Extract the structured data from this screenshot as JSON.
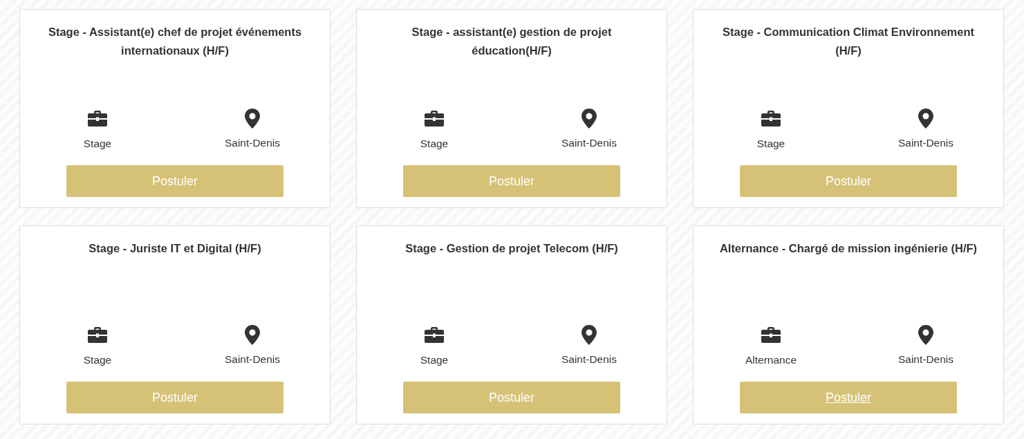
{
  "jobs": [
    {
      "title": "Stage - Assistant(e) chef de projet événements internationaux (H/F)",
      "contract_type": "Stage",
      "location": "Saint-Denis",
      "apply_button": {
        "label": "Postuler",
        "hovered": false
      }
    },
    {
      "title": "Stage - assistant(e) gestion de projet éducation(H/F)",
      "contract_type": "Stage",
      "location": "Saint-Denis",
      "apply_button": {
        "label": "Postuler",
        "hovered": false
      }
    },
    {
      "title": "Stage - Communication Climat Environnement (H/F)",
      "contract_type": "Stage",
      "location": "Saint-Denis",
      "apply_button": {
        "label": "Postuler",
        "hovered": false
      }
    },
    {
      "title": "Stage - Juriste IT et Digital (H/F)",
      "contract_type": "Stage",
      "location": "Saint-Denis",
      "apply_button": {
        "label": "Postuler",
        "hovered": false
      }
    },
    {
      "title": "Stage - Gestion de projet Telecom (H/F)",
      "contract_type": "Stage",
      "location": "Saint-Denis",
      "apply_button": {
        "label": "Postuler",
        "hovered": false
      }
    },
    {
      "title": "Alternance - Chargé de mission ingénierie (H/F)",
      "contract_type": "Alternance",
      "location": "Saint-Denis",
      "apply_button": {
        "label": "Postuler",
        "hovered": true
      }
    }
  ]
}
